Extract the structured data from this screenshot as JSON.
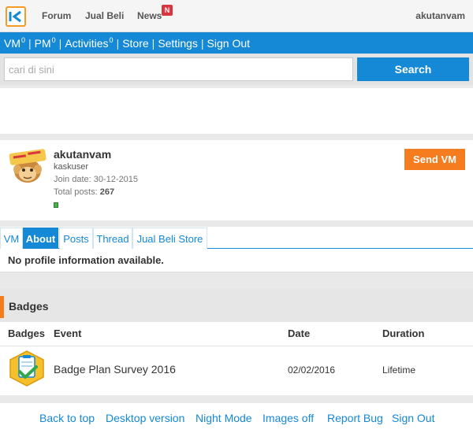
{
  "topbar": {
    "logo_icon": "kaskus-logo",
    "nav": {
      "forum": "Forum",
      "jual_beli": "Jual Beli",
      "news": "News",
      "news_badge": "N"
    },
    "username": "akutanvam"
  },
  "userbar": {
    "vm": "VM",
    "vm_count": "0",
    "pm": "PM",
    "pm_count": "0",
    "activities": "Activities",
    "activities_count": "0",
    "store": "Store",
    "settings": "Settings",
    "signout": "Sign Out",
    "separator": "|"
  },
  "search": {
    "placeholder": "cari di sini",
    "value": "",
    "button": "Search"
  },
  "profile": {
    "name": "akutanvam",
    "title": "kaskuser",
    "join_label": "Join date:",
    "join_date": "30-12-2015",
    "posts_label": "Total posts:",
    "posts": "267",
    "avatar_icon": "monkey-avatar",
    "status_icon": "online-status-icon",
    "send_vm": "Send VM"
  },
  "tabs": [
    "VM",
    "About",
    "Posts",
    "Thread",
    "Jual Beli Store"
  ],
  "active_tab": "About",
  "about": {
    "empty_message": "No profile information available."
  },
  "badges": {
    "section_title": "Badges",
    "columns": {
      "badges": "Badges",
      "event": "Event",
      "date": "Date",
      "duration": "Duration"
    },
    "rows": [
      {
        "icon": "survey-badge-icon",
        "event": "Badge Plan Survey 2016",
        "date": "02/02/2016",
        "duration": "Lifetime"
      }
    ]
  },
  "footer": {
    "back_to_top": "Back to top",
    "desktop_version": "Desktop version",
    "night_mode": "Night Mode",
    "images_off": "Images off",
    "report_bug": "Report Bug",
    "sign_out": "Sign Out"
  },
  "colors": {
    "primary_blue": "#1588d6",
    "accent_orange": "#f57c1f",
    "news_red": "#d9363e"
  }
}
